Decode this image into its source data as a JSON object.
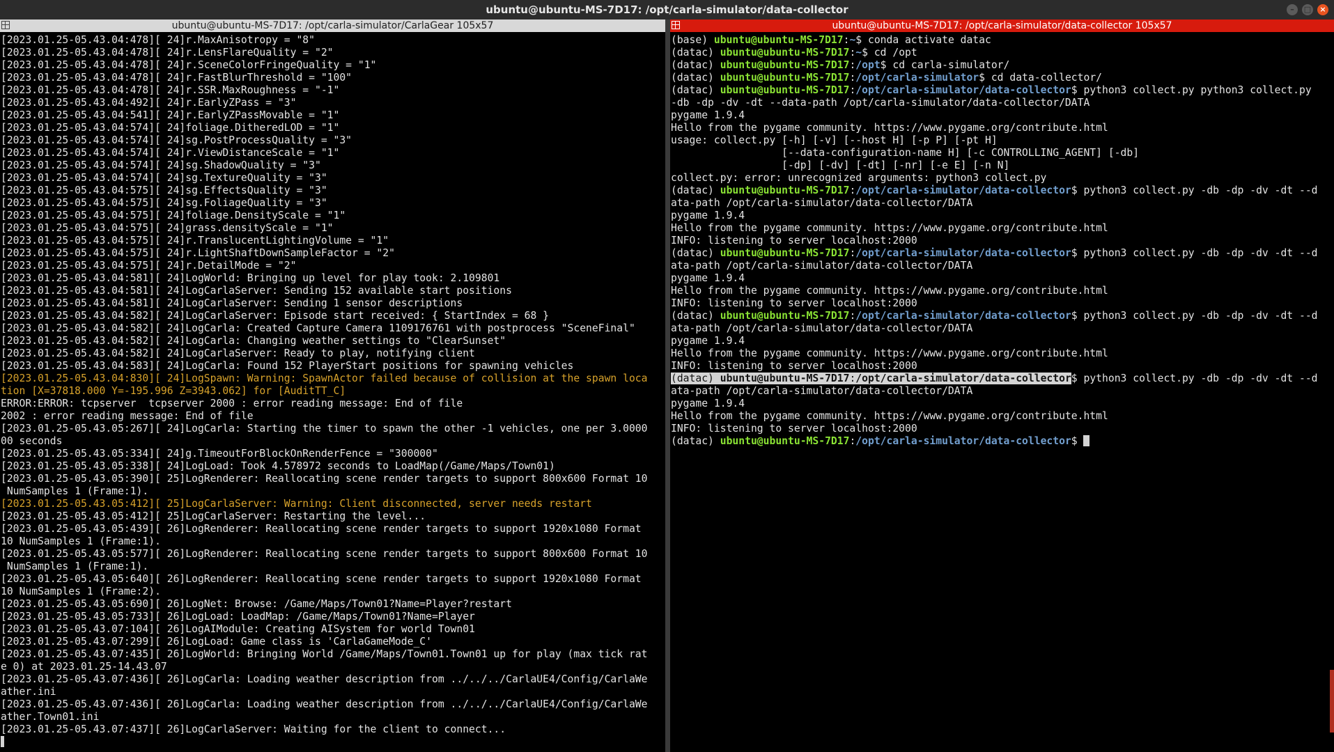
{
  "window": {
    "title": "ubuntu@ubuntu-MS-7D17: /opt/carla-simulator/data-collector",
    "controls": [
      "minimize-icon",
      "maximize-icon",
      "close-icon"
    ]
  },
  "left_pane": {
    "title": "ubuntu@ubuntu-MS-7D17: /opt/carla-simulator/CarlaGear 105x57",
    "lines": [
      "[2023.01.25-05.43.04:478][ 24]r.MaxAnisotropy = \"8\"",
      "[2023.01.25-05.43.04:478][ 24]r.LensFlareQuality = \"2\"",
      "[2023.01.25-05.43.04:478][ 24]r.SceneColorFringeQuality = \"1\"",
      "[2023.01.25-05.43.04:478][ 24]r.FastBlurThreshold = \"100\"",
      "[2023.01.25-05.43.04:478][ 24]r.SSR.MaxRoughness = \"-1\"",
      "[2023.01.25-05.43.04:492][ 24]r.EarlyZPass = \"3\"",
      "[2023.01.25-05.43.04:541][ 24]r.EarlyZPassMovable = \"1\"",
      "[2023.01.25-05.43.04:574][ 24]foliage.DitheredLOD = \"1\"",
      "[2023.01.25-05.43.04:574][ 24]sg.PostProcessQuality = \"3\"",
      "[2023.01.25-05.43.04:574][ 24]r.ViewDistanceScale = \"1\"",
      "[2023.01.25-05.43.04:574][ 24]sg.ShadowQuality = \"3\"",
      "[2023.01.25-05.43.04:574][ 24]sg.TextureQuality = \"3\"",
      "[2023.01.25-05.43.04:575][ 24]sg.EffectsQuality = \"3\"",
      "[2023.01.25-05.43.04:575][ 24]sg.FoliageQuality = \"3\"",
      "[2023.01.25-05.43.04:575][ 24]foliage.DensityScale = \"1\"",
      "[2023.01.25-05.43.04:575][ 24]grass.densityScale = \"1\"",
      "[2023.01.25-05.43.04:575][ 24]r.TranslucentLightingVolume = \"1\"",
      "[2023.01.25-05.43.04:575][ 24]r.LightShaftDownSampleFactor = \"2\"",
      "[2023.01.25-05.43.04:575][ 24]r.DetailMode = \"2\"",
      "[2023.01.25-05.43.04:581][ 24]LogWorld: Bringing up level for play took: 2.109801",
      "[2023.01.25-05.43.04:581][ 24]LogCarlaServer: Sending 152 available start positions",
      "[2023.01.25-05.43.04:581][ 24]LogCarlaServer: Sending 1 sensor descriptions",
      "[2023.01.25-05.43.04:582][ 24]LogCarlaServer: Episode start received: { StartIndex = 68 }",
      "[2023.01.25-05.43.04:582][ 24]LogCarla: Created Capture Camera 1109176761 with postprocess \"SceneFinal\"",
      "[2023.01.25-05.43.04:582][ 24]LogCarla: Changing weather settings to \"ClearSunset\"",
      "[2023.01.25-05.43.04:582][ 24]LogCarlaServer: Ready to play, notifying client",
      "[2023.01.25-05.43.04:583][ 24]LogCarla: Found 152 PlayerStart positions for spawning vehicles",
      "[2023.01.25-05.43.04:830][ 24]LogSpawn: Warning: SpawnActor failed because of collision at the spawn loca",
      "tion [X=37818.000 Y=-195.996 Z=3943.062] for [AuditTT_C]",
      "ERROR:ERROR: tcpserver  tcpserver 2000 : error reading message: End of file",
      "2002 : error reading message: End of file",
      "[2023.01.25-05.43.05:267][ 24]LogCarla: Starting the timer to spawn the other -1 vehicles, one per 3.0000",
      "00 seconds",
      "[2023.01.25-05.43.05:334][ 24]g.TimeoutForBlockOnRenderFence = \"300000\"",
      "[2023.01.25-05.43.05:338][ 24]LogLoad: Took 4.578972 seconds to LoadMap(/Game/Maps/Town01)",
      "[2023.01.25-05.43.05:390][ 25]LogRenderer: Reallocating scene render targets to support 800x600 Format 10",
      " NumSamples 1 (Frame:1).",
      "[2023.01.25-05.43.05:412][ 25]LogCarlaServer: Warning: Client disconnected, server needs restart",
      "[2023.01.25-05.43.05:412][ 25]LogCarlaServer: Restarting the level...",
      "[2023.01.25-05.43.05:439][ 26]LogRenderer: Reallocating scene render targets to support 1920x1080 Format",
      "10 NumSamples 1 (Frame:1).",
      "[2023.01.25-05.43.05:577][ 26]LogRenderer: Reallocating scene render targets to support 800x600 Format 10",
      " NumSamples 1 (Frame:1).",
      "[2023.01.25-05.43.05:640][ 26]LogRenderer: Reallocating scene render targets to support 1920x1080 Format",
      "10 NumSamples 1 (Frame:2).",
      "[2023.01.25-05.43.05:690][ 26]LogNet: Browse: /Game/Maps/Town01?Name=Player?restart",
      "[2023.01.25-05.43.05:733][ 26]LogLoad: LoadMap: /Game/Maps/Town01?Name=Player",
      "[2023.01.25-05.43.07:104][ 26]LogAIModule: Creating AISystem for world Town01",
      "[2023.01.25-05.43.07:299][ 26]LogLoad: Game class is 'CarlaGameMode_C'",
      "[2023.01.25-05.43.07:435][ 26]LogWorld: Bringing World /Game/Maps/Town01.Town01 up for play (max tick rat",
      "e 0) at 2023.01.25-14.43.07",
      "[2023.01.25-05.43.07:436][ 26]LogCarla: Loading weather description from ../../../CarlaUE4/Config/CarlaWe",
      "ather.ini",
      "[2023.01.25-05.43.07:436][ 26]LogCarla: Loading weather description from ../../../CarlaUE4/Config/CarlaWe",
      "ather.Town01.ini",
      "[2023.01.25-05.43.07:437][ 26]LogCarlaServer: Waiting for the client to connect..."
    ],
    "warning_color": "#d7a22b"
  },
  "right_pane": {
    "title": "ubuntu@ubuntu-MS-7D17: /opt/carla-simulator/data-collector 105x57",
    "user": "ubuntu@ubuntu-MS-7D17",
    "lines": [
      {
        "kind": "prompt",
        "env": "(base) ",
        "path": "~",
        "cmd": "conda activate datac"
      },
      {
        "kind": "prompt",
        "env": "(datac) ",
        "path": "~",
        "cmd": "cd /opt"
      },
      {
        "kind": "prompt",
        "env": "(datac) ",
        "path": "/opt",
        "cmd": "cd carla-simulator/"
      },
      {
        "kind": "prompt",
        "env": "(datac) ",
        "path": "/opt/carla-simulator",
        "cmd": "cd data-collector/"
      },
      {
        "kind": "prompt",
        "env": "(datac) ",
        "path": "/opt/carla-simulator/data-collector",
        "cmd": "python3 collect.py python3 collect.py"
      },
      {
        "kind": "text",
        "text": "-db -dp -dv -dt --data-path /opt/carla-simulator/data-collector/DATA"
      },
      {
        "kind": "text",
        "text": "pygame 1.9.4"
      },
      {
        "kind": "text",
        "text": "Hello from the pygame community. https://www.pygame.org/contribute.html"
      },
      {
        "kind": "text",
        "text": "usage: collect.py [-h] [-v] [--host H] [-p P] [-pt H]"
      },
      {
        "kind": "text",
        "text": "                  [--data-configuration-name H] [-c CONTROLLING_AGENT] [-db]"
      },
      {
        "kind": "text",
        "text": "                  [-dp] [-dv] [-dt] [-nr] [-e E] [-n N]"
      },
      {
        "kind": "text",
        "text": "collect.py: error: unrecognized arguments: python3 collect.py"
      },
      {
        "kind": "prompt",
        "env": "(datac) ",
        "path": "/opt/carla-simulator/data-collector",
        "cmd": "python3 collect.py -db -dp -dv -dt --d"
      },
      {
        "kind": "text",
        "text": "ata-path /opt/carla-simulator/data-collector/DATA"
      },
      {
        "kind": "text",
        "text": "pygame 1.9.4"
      },
      {
        "kind": "text",
        "text": "Hello from the pygame community. https://www.pygame.org/contribute.html"
      },
      {
        "kind": "text",
        "text": "INFO: listening to server localhost:2000"
      },
      {
        "kind": "prompt",
        "env": "(datac) ",
        "path": "/opt/carla-simulator/data-collector",
        "cmd": "python3 collect.py -db -dp -dv -dt --d"
      },
      {
        "kind": "text",
        "text": "ata-path /opt/carla-simulator/data-collector/DATA"
      },
      {
        "kind": "text",
        "text": "pygame 1.9.4"
      },
      {
        "kind": "text",
        "text": "Hello from the pygame community. https://www.pygame.org/contribute.html"
      },
      {
        "kind": "text",
        "text": "INFO: listening to server localhost:2000"
      },
      {
        "kind": "prompt",
        "env": "(datac) ",
        "path": "/opt/carla-simulator/data-collector",
        "cmd": "python3 collect.py -db -dp -dv -dt --d"
      },
      {
        "kind": "text",
        "text": "ata-path /opt/carla-simulator/data-collector/DATA"
      },
      {
        "kind": "text",
        "text": "pygame 1.9.4"
      },
      {
        "kind": "text",
        "text": "Hello from the pygame community. https://www.pygame.org/contribute.html"
      },
      {
        "kind": "text",
        "text": "INFO: listening to server localhost:2000"
      },
      {
        "kind": "prompt",
        "env": "(datac) ",
        "path": "/opt/carla-simulator/data-collector",
        "cmd": "python3 collect.py -db -dp -dv -dt --d",
        "selected": true
      },
      {
        "kind": "text",
        "text": "ata-path /opt/carla-simulator/data-collector/DATA"
      },
      {
        "kind": "text",
        "text": "pygame 1.9.4"
      },
      {
        "kind": "text",
        "text": "Hello from the pygame community. https://www.pygame.org/contribute.html"
      },
      {
        "kind": "text",
        "text": "INFO: listening to server localhost:2000"
      },
      {
        "kind": "prompt",
        "env": "(datac) ",
        "path": "/opt/carla-simulator/data-collector",
        "cmd": "",
        "cursor": true
      }
    ],
    "colors": {
      "user": "#8ae234",
      "path": "#729fcf",
      "title_bar": "#d71b0d"
    }
  }
}
